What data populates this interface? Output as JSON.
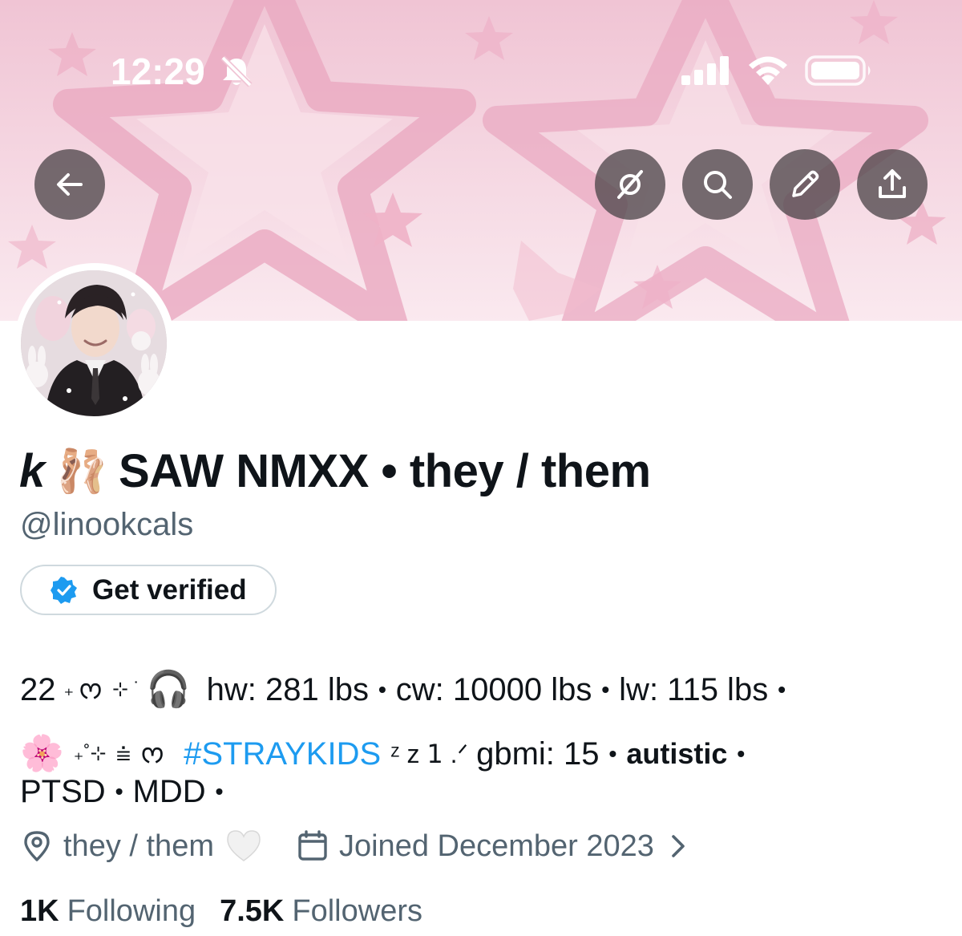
{
  "status_bar": {
    "time": "12:29"
  },
  "colors": {
    "accent": "#1d9bf0",
    "secondary_text": "#536471",
    "primary_text": "#0f1419",
    "banner_pink": "#f3cfdc"
  },
  "header": {
    "icons": [
      "back-arrow-icon",
      "grok-icon",
      "search-icon",
      "pencil-icon",
      "share-icon"
    ]
  },
  "profile": {
    "name_prefix": "k",
    "name_emoji": "🩰",
    "name_main": "SAW NMXX • they / them",
    "handle": "@linookcals",
    "get_verified_label": "Get verified"
  },
  "bio": {
    "line1": {
      "age": "22",
      "deco1": "₊",
      "deco2": "ᰔ",
      "deco3": "⊹ ˙",
      "headphones": "🎧",
      "hw": "hw: 281 lbs",
      "cw": "cw: 10000 lbs",
      "lw": "lw: 115 lbs",
      "dot": "•"
    },
    "line2": {
      "flower": "🌸",
      "deco1": "₊˚⊹",
      "deco2": "⩧",
      "deco3": "ᰔ",
      "hashtag": "#STRAYKIDS",
      "deco4": "ᶻ z 𝟣 .ᐟ",
      "gbmi": "gbmi: 15",
      "autistic": "autistic"
    },
    "line3": {
      "ptsd": "PTSD",
      "mdd": "MDD"
    }
  },
  "meta": {
    "location": "they / them",
    "heart": "🤍",
    "joined": "Joined December 2023"
  },
  "stats": {
    "following_count": "1K",
    "following_label": "Following",
    "followers_count": "7.5K",
    "followers_label": "Followers"
  }
}
